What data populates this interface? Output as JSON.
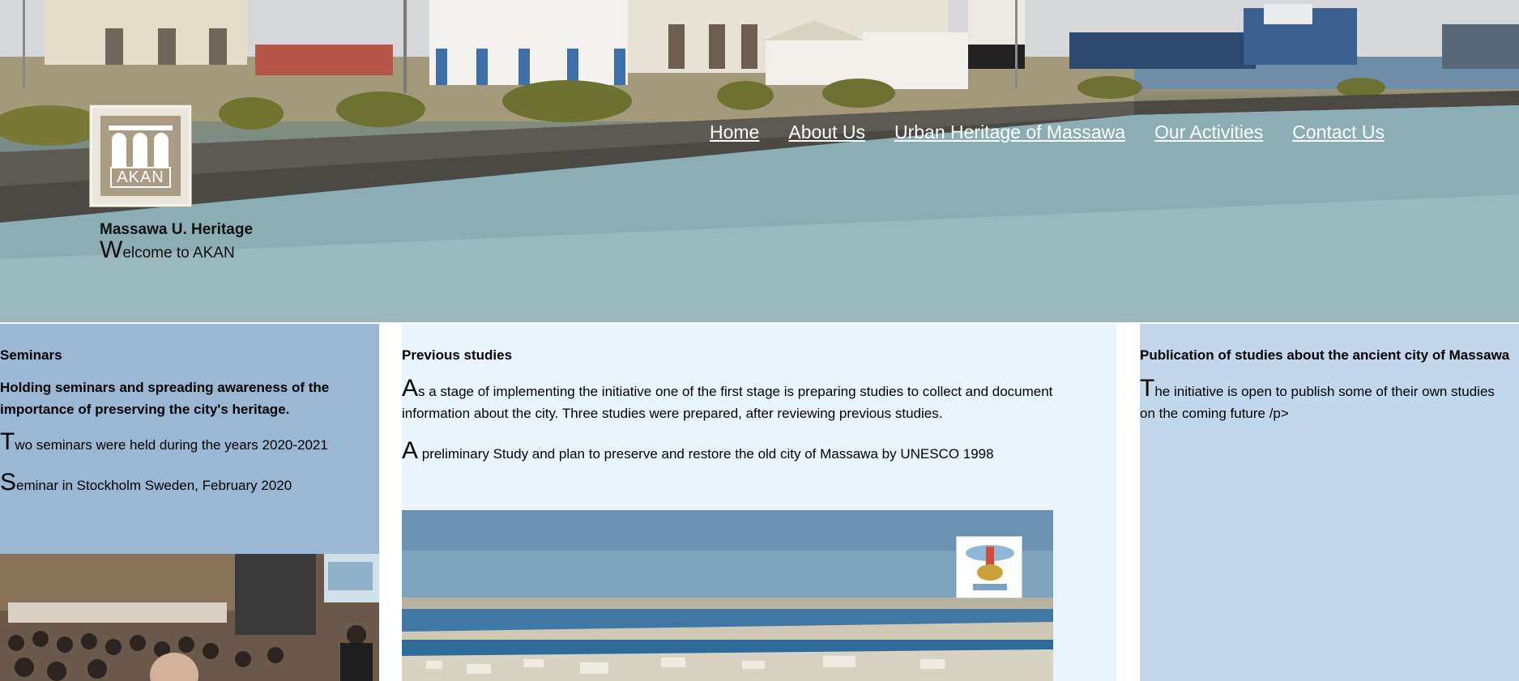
{
  "site": {
    "title": "Massawa U. Heritage",
    "welcome_cap": "W",
    "welcome_rest": "elcome to AKAN",
    "logo_text": "AKAN"
  },
  "nav": {
    "items": [
      {
        "label": "Home"
      },
      {
        "label": "About Us"
      },
      {
        "label": "Urban Heritage of Massawa"
      },
      {
        "label": "Our Activities"
      },
      {
        "label": "Contact Us"
      }
    ]
  },
  "seminars": {
    "heading": "Seminars",
    "subheading": "Holding seminars and spreading awareness of the importance of preserving the city's heritage.",
    "p1_cap": "T",
    "p1_rest": "wo seminars were held during the years 2020-2021",
    "p2_cap": "S",
    "p2_rest": "eminar in Stockholm Sweden, February 2020"
  },
  "studies": {
    "heading": "Previous studies",
    "p1_cap": "A",
    "p1_rest": "s a stage of implementing the initiative one of the first stage is preparing studies to collect and document information about the city. Three studies were prepared, after reviewing previous studies.",
    "p2_cap": "A",
    "p2_rest": " preliminary Study and plan to preserve and restore the old city of Massawa by UNESCO 1998"
  },
  "publication": {
    "heading": "Publication of studies about the ancient city of Massawa",
    "p1_cap": "T",
    "p1_rest": "he initiative is open to publish some of their own studies on the coming future /p>"
  },
  "colors": {
    "left_panel": "#9ab8d4",
    "middle_panel": "#eaf4fc",
    "right_panel": "#c1d8ec"
  }
}
